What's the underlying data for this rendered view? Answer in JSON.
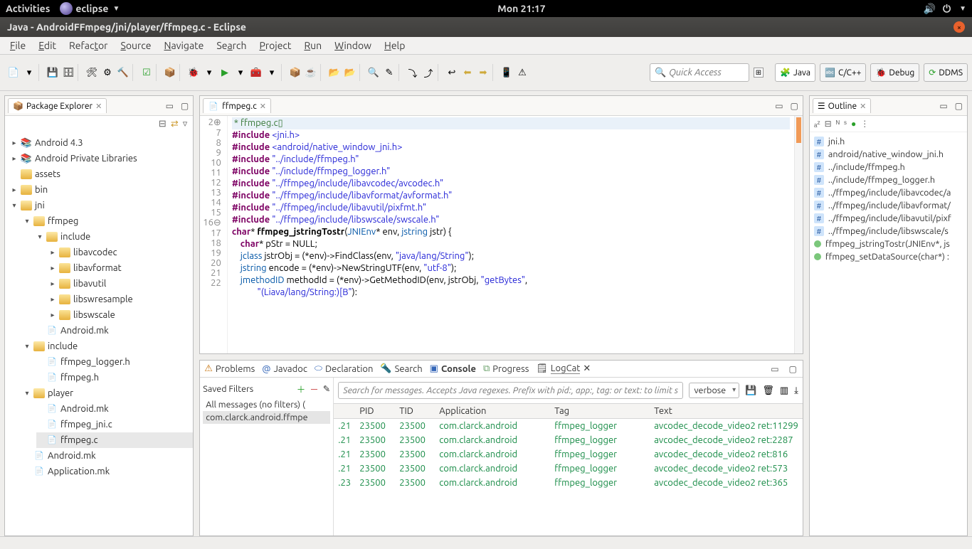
{
  "os": {
    "activities": "Activities",
    "app": "eclipse",
    "clock": "Mon 21:17"
  },
  "window": {
    "title": "Java - AndroidFFmpeg/jni/player/ffmpeg.c - Eclipse"
  },
  "menu": [
    "File",
    "Edit",
    "Refactor",
    "Source",
    "Navigate",
    "Search",
    "Project",
    "Run",
    "Window",
    "Help"
  ],
  "quick_access_placeholder": "Quick Access",
  "perspectives": [
    {
      "label": "Java",
      "active": true
    },
    {
      "label": "C/C++",
      "active": false
    },
    {
      "label": "Debug",
      "active": false
    },
    {
      "label": "DDMS",
      "active": false
    }
  ],
  "package_explorer": {
    "title": "Package Explorer",
    "tree": {
      "android43": "Android 4.3",
      "private_libs": "Android Private Libraries",
      "assets": "assets",
      "bin": "bin",
      "jni": "jni",
      "ffmpeg": "ffmpeg",
      "include": "include",
      "libavcodec": "libavcodec",
      "libavformat": "libavformat",
      "libavutil": "libavutil",
      "libswresample": "libswresample",
      "libswscale": "libswscale",
      "android_mk": "Android.mk",
      "include2": "include",
      "ffmpeg_logger_h": "ffmpeg_logger.h",
      "ffmpeg_h": "ffmpeg.h",
      "player": "player",
      "android_mk2": "Android.mk",
      "ffmpeg_jni_c": "ffmpeg_jni.c",
      "ffmpeg_c": "ffmpeg.c",
      "android_mk3": "Android.mk",
      "application_mk": "Application.mk"
    }
  },
  "editor": {
    "tab": "ffmpeg.c",
    "lines": [
      {
        "n": "2⊕",
        "raw": " * ffmpeg.c▯",
        "cls": "cm hilite"
      },
      {
        "n": "7",
        "html": "<span class=\"kw\">#include</span> <span class=\"str\">&lt;jni.h&gt;</span>"
      },
      {
        "n": "8",
        "html": "<span class=\"kw\">#include</span> <span class=\"str\">&lt;android/native_window_jni.h&gt;</span>"
      },
      {
        "n": "9",
        "html": "<span class=\"kw\">#include</span> <span class=\"str\">\"../include/ffmpeg.h\"</span>"
      },
      {
        "n": "10",
        "html": "<span class=\"kw\">#include</span> <span class=\"str\">\"../include/ffmpeg_logger.h\"</span>"
      },
      {
        "n": "11",
        "html": "<span class=\"kw\">#include</span> <span class=\"str\">\"../ffmpeg/include/libavcodec/avcodec.h\"</span>"
      },
      {
        "n": "12",
        "html": "<span class=\"kw\">#include</span> <span class=\"str\">\"../ffmpeg/include/libavformat/avformat.h\"</span>"
      },
      {
        "n": "13",
        "html": "<span class=\"kw\">#include</span> <span class=\"str\">\"../ffmpeg/include/libavutil/pixfmt.h\"</span>"
      },
      {
        "n": "14",
        "html": "<span class=\"kw\">#include</span> <span class=\"str\">\"../ffmpeg/include/libswscale/swscale.h\"</span>"
      },
      {
        "n": "15",
        "html": ""
      },
      {
        "n": "16⊖",
        "html": "<span class=\"kw\">char</span>* <span class=\"fn\">ffmpeg_jstringTostr</span>(<span class=\"type\">JNIEnv</span>* env, <span class=\"type\">jstring</span> jstr) {"
      },
      {
        "n": "17",
        "html": "    <span class=\"kw\">char</span>* pStr = NULL;"
      },
      {
        "n": "18",
        "html": ""
      },
      {
        "n": "19",
        "html": "    <span class=\"type\">jclass</span> jstrObj = (*env)-&gt;FindClass(env, <span class=\"str\">\"java/lang/String\"</span>);"
      },
      {
        "n": "20",
        "html": "    <span class=\"type\">jstring</span> encode = (*env)-&gt;NewStringUTF(env, <span class=\"str\">\"utf-8\"</span>);"
      },
      {
        "n": "21",
        "html": "    <span class=\"type\">jmethodID</span> methodId = (*env)-&gt;GetMethodID(env, jstrObj, <span class=\"str\">\"getBytes\"</span>,"
      },
      {
        "n": "22",
        "html": "            <span class=\"str\">\"(Liava/lang/String:)[B\"</span>):"
      }
    ]
  },
  "outline": {
    "title": "Outline",
    "items": [
      {
        "type": "inc",
        "label": "jni.h"
      },
      {
        "type": "inc",
        "label": "android/native_window_jni.h"
      },
      {
        "type": "inc",
        "label": "../include/ffmpeg.h"
      },
      {
        "type": "inc",
        "label": "../include/ffmpeg_logger.h"
      },
      {
        "type": "inc",
        "label": "../ffmpeg/include/libavcodec/a"
      },
      {
        "type": "inc",
        "label": "../ffmpeg/include/libavformat/"
      },
      {
        "type": "inc",
        "label": "../ffmpeg/include/libavutil/pixf"
      },
      {
        "type": "inc",
        "label": "../ffmpeg/include/libswscale/s"
      },
      {
        "type": "fn",
        "label": "ffmpeg_jstringTostr(JNIEnv*, js"
      },
      {
        "type": "fn",
        "label": "ffmpeg_setDataSource(char*) :"
      }
    ]
  },
  "bottom": {
    "tabs": [
      "Problems",
      "Javadoc",
      "Declaration",
      "Search",
      "Console",
      "Progress",
      "LogCat"
    ],
    "active_tab": "LogCat",
    "filters_title": "Saved Filters",
    "filter_all": "All messages (no filters) (",
    "filter_sel": "com.clarck.android.ffmpe",
    "search_placeholder": "Search for messages. Accepts Java regexes. Prefix with pid:, app:, tag: or text: to limit sco",
    "level": "verbose",
    "columns": [
      "",
      "PID",
      "TID",
      "Application",
      "Tag",
      "Text"
    ],
    "rows": [
      {
        "t": ".21",
        "pid": "23500",
        "tid": "23500",
        "app": "com.clarck.android",
        "tag": "ffmpeg_logger",
        "text": "avcodec_decode_video2 ret:11299"
      },
      {
        "t": ".21",
        "pid": "23500",
        "tid": "23500",
        "app": "com.clarck.android",
        "tag": "ffmpeg_logger",
        "text": "avcodec_decode_video2 ret:2287"
      },
      {
        "t": ".21",
        "pid": "23500",
        "tid": "23500",
        "app": "com.clarck.android",
        "tag": "ffmpeg_logger",
        "text": "avcodec_decode_video2 ret:816"
      },
      {
        "t": ".21",
        "pid": "23500",
        "tid": "23500",
        "app": "com.clarck.android",
        "tag": "ffmpeg_logger",
        "text": "avcodec_decode_video2 ret:573"
      },
      {
        "t": ".23",
        "pid": "23500",
        "tid": "23500",
        "app": "com.clarck.android",
        "tag": "ffmpeg_logger",
        "text": "avcodec_decode_video2 ret:365"
      }
    ]
  }
}
